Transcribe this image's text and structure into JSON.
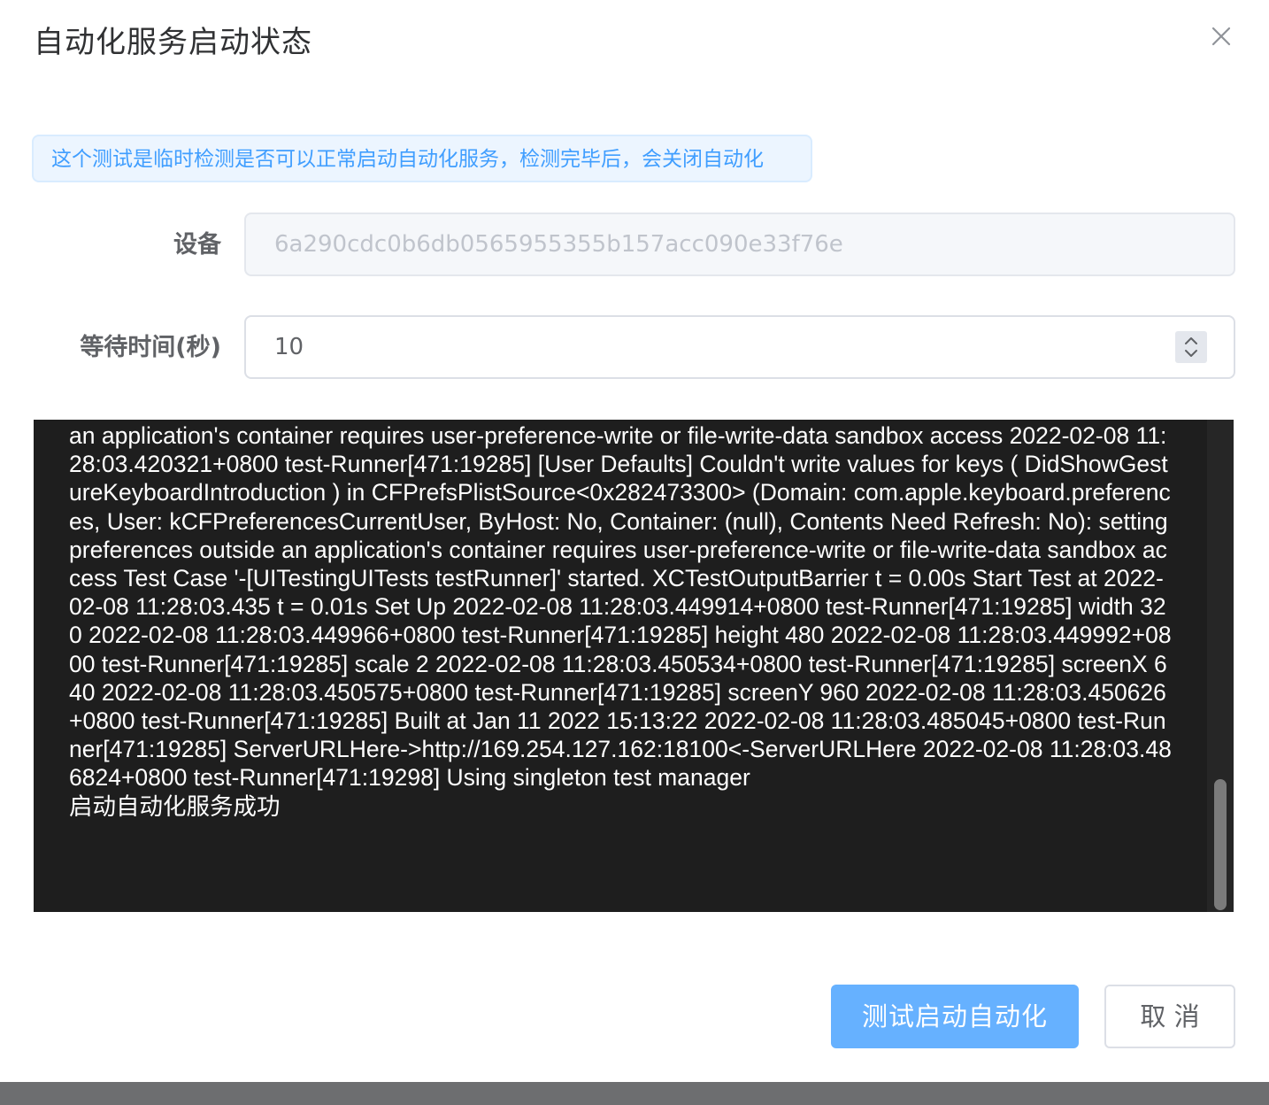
{
  "dialog": {
    "title": "自动化服务启动状态",
    "close_icon": "close-icon"
  },
  "alert": {
    "type": "info",
    "text": "这个测试是临时检测是否可以正常启动自动化服务，检测完毕后，会关闭自动化"
  },
  "form": {
    "device_label": "设备",
    "device_value": "6a290cdc0b6db0565955355b157acc090e33f76e",
    "wait_label": "等待时间(秒)",
    "wait_value": "10",
    "stepper_icon": "stepper-up-down-icon"
  },
  "console": {
    "log": "an application's container requires user-preference-write or file-write-data sandbox access 2022-02-08 11:28:03.420321+0800 test-Runner[471:19285] [User Defaults] Couldn't write values for keys ( DidShowGestureKeyboardIntroduction ) in CFPrefsPlistSource<0x282473300> (Domain: com.apple.keyboard.preferences, User: kCFPreferencesCurrentUser, ByHost: No, Container: (null), Contents Need Refresh: No): setting preferences outside an application's container requires user-preference-write or file-write-data sandbox access Test Case '-[UITestingUITests testRunner]' started. XCTestOutputBarrier t = 0.00s Start Test at 2022-02-08 11:28:03.435 t = 0.01s Set Up 2022-02-08 11:28:03.449914+0800 test-Runner[471:19285] width 320 2022-02-08 11:28:03.449966+0800 test-Runner[471:19285] height 480 2022-02-08 11:28:03.449992+0800 test-Runner[471:19285] scale 2 2022-02-08 11:28:03.450534+0800 test-Runner[471:19285] screenX 640 2022-02-08 11:28:03.450575+0800 test-Runner[471:19285] screenY 960 2022-02-08 11:28:03.450626+0800 test-Runner[471:19285] Built at Jan 11 2022 15:13:22 2022-02-08 11:28:03.485045+0800 test-Runner[471:19285] ServerURLHere->http://169.254.127.162:18100<-ServerURLHere 2022-02-08 11:28:03.486824+0800 test-Runner[471:19298] Using singleton test manager",
    "status": "启动自动化服务成功"
  },
  "footer": {
    "test_button": "测试启动自动化",
    "cancel_button": "取 消"
  },
  "colors": {
    "primary": "#66b1ff",
    "alert_text": "#409eff",
    "console_bg": "#1e1e1e"
  }
}
